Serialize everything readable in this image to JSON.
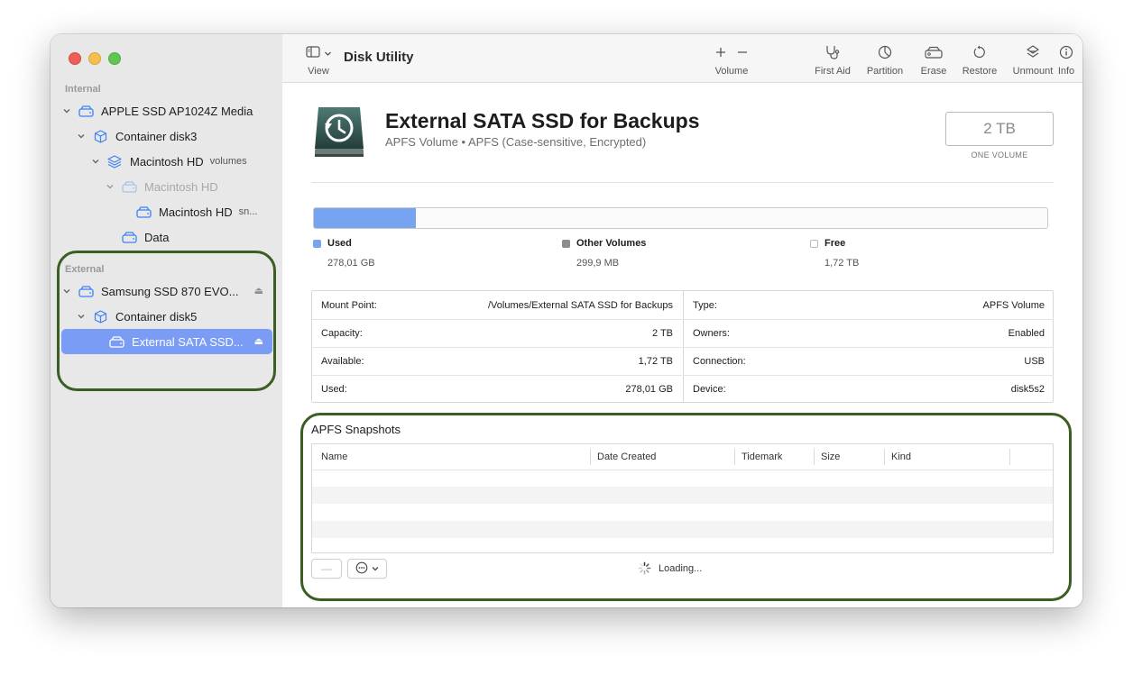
{
  "sidebar": {
    "section_internal": "Internal",
    "section_external": "External",
    "items": [
      {
        "label": "APPLE SSD AP1024Z Media"
      },
      {
        "label": "Container disk3"
      },
      {
        "label": "Macintosh HD",
        "sub": "volumes"
      },
      {
        "label": "Macintosh HD"
      },
      {
        "label": "Macintosh HD",
        "sub": "sn..."
      },
      {
        "label": "Data"
      },
      {
        "label": "Samsung SSD 870 EVO..."
      },
      {
        "label": "Container disk5"
      },
      {
        "label": "External SATA SSD..."
      }
    ],
    "eject_glyph": "⏏"
  },
  "toolbar": {
    "title": "Disk Utility",
    "view_label": "View",
    "volume_label": "Volume",
    "first_aid_label": "First Aid",
    "partition_label": "Partition",
    "erase_label": "Erase",
    "restore_label": "Restore",
    "unmount_label": "Unmount",
    "info_label": "Info"
  },
  "volume": {
    "name": "External SATA SSD for Backups",
    "subtitle": "APFS Volume • APFS (Case-sensitive, Encrypted)",
    "size": "2 TB",
    "size_caption": "ONE VOLUME",
    "used_fraction": 0.139
  },
  "legend": {
    "used_label": "Used",
    "used_value": "278,01 GB",
    "other_label": "Other Volumes",
    "other_value": "299,9 MB",
    "free_label": "Free",
    "free_value": "1,72 TB"
  },
  "info": {
    "left": [
      {
        "key": "Mount Point:",
        "value": "/Volumes/External SATA SSD for Backups"
      },
      {
        "key": "Capacity:",
        "value": "2 TB"
      },
      {
        "key": "Available:",
        "value": "1,72 TB"
      },
      {
        "key": "Used:",
        "value": "278,01 GB"
      }
    ],
    "right": [
      {
        "key": "Type:",
        "value": "APFS Volume"
      },
      {
        "key": "Owners:",
        "value": "Enabled"
      },
      {
        "key": "Connection:",
        "value": "USB"
      },
      {
        "key": "Device:",
        "value": "disk5s2"
      }
    ]
  },
  "snapshots": {
    "title": "APFS Snapshots",
    "columns": [
      "Name",
      "Date Created",
      "Tidemark",
      "Size",
      "Kind"
    ],
    "remove_glyph": "—",
    "loading_text": "Loading..."
  },
  "colors": {
    "accent": "#7a9cf5",
    "used": "#76a4f0",
    "other": "#8c8c8c",
    "highlight": "#3b5e23"
  }
}
